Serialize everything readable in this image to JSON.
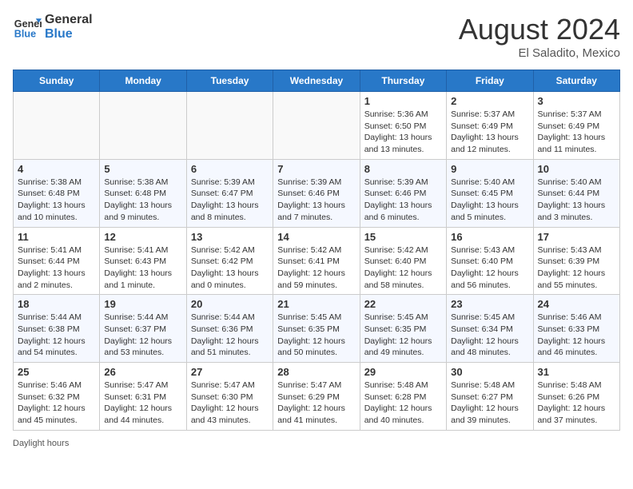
{
  "header": {
    "logo_line1": "General",
    "logo_line2": "Blue",
    "month_year": "August 2024",
    "location": "El Saladito, Mexico"
  },
  "days_of_week": [
    "Sunday",
    "Monday",
    "Tuesday",
    "Wednesday",
    "Thursday",
    "Friday",
    "Saturday"
  ],
  "footer_text": "Daylight hours",
  "weeks": [
    [
      {
        "day": "",
        "info": ""
      },
      {
        "day": "",
        "info": ""
      },
      {
        "day": "",
        "info": ""
      },
      {
        "day": "",
        "info": ""
      },
      {
        "day": "1",
        "info": "Sunrise: 5:36 AM\nSunset: 6:50 PM\nDaylight: 13 hours\nand 13 minutes."
      },
      {
        "day": "2",
        "info": "Sunrise: 5:37 AM\nSunset: 6:49 PM\nDaylight: 13 hours\nand 12 minutes."
      },
      {
        "day": "3",
        "info": "Sunrise: 5:37 AM\nSunset: 6:49 PM\nDaylight: 13 hours\nand 11 minutes."
      }
    ],
    [
      {
        "day": "4",
        "info": "Sunrise: 5:38 AM\nSunset: 6:48 PM\nDaylight: 13 hours\nand 10 minutes."
      },
      {
        "day": "5",
        "info": "Sunrise: 5:38 AM\nSunset: 6:48 PM\nDaylight: 13 hours\nand 9 minutes."
      },
      {
        "day": "6",
        "info": "Sunrise: 5:39 AM\nSunset: 6:47 PM\nDaylight: 13 hours\nand 8 minutes."
      },
      {
        "day": "7",
        "info": "Sunrise: 5:39 AM\nSunset: 6:46 PM\nDaylight: 13 hours\nand 7 minutes."
      },
      {
        "day": "8",
        "info": "Sunrise: 5:39 AM\nSunset: 6:46 PM\nDaylight: 13 hours\nand 6 minutes."
      },
      {
        "day": "9",
        "info": "Sunrise: 5:40 AM\nSunset: 6:45 PM\nDaylight: 13 hours\nand 5 minutes."
      },
      {
        "day": "10",
        "info": "Sunrise: 5:40 AM\nSunset: 6:44 PM\nDaylight: 13 hours\nand 3 minutes."
      }
    ],
    [
      {
        "day": "11",
        "info": "Sunrise: 5:41 AM\nSunset: 6:44 PM\nDaylight: 13 hours\nand 2 minutes."
      },
      {
        "day": "12",
        "info": "Sunrise: 5:41 AM\nSunset: 6:43 PM\nDaylight: 13 hours\nand 1 minute."
      },
      {
        "day": "13",
        "info": "Sunrise: 5:42 AM\nSunset: 6:42 PM\nDaylight: 13 hours\nand 0 minutes."
      },
      {
        "day": "14",
        "info": "Sunrise: 5:42 AM\nSunset: 6:41 PM\nDaylight: 12 hours\nand 59 minutes."
      },
      {
        "day": "15",
        "info": "Sunrise: 5:42 AM\nSunset: 6:40 PM\nDaylight: 12 hours\nand 58 minutes."
      },
      {
        "day": "16",
        "info": "Sunrise: 5:43 AM\nSunset: 6:40 PM\nDaylight: 12 hours\nand 56 minutes."
      },
      {
        "day": "17",
        "info": "Sunrise: 5:43 AM\nSunset: 6:39 PM\nDaylight: 12 hours\nand 55 minutes."
      }
    ],
    [
      {
        "day": "18",
        "info": "Sunrise: 5:44 AM\nSunset: 6:38 PM\nDaylight: 12 hours\nand 54 minutes."
      },
      {
        "day": "19",
        "info": "Sunrise: 5:44 AM\nSunset: 6:37 PM\nDaylight: 12 hours\nand 53 minutes."
      },
      {
        "day": "20",
        "info": "Sunrise: 5:44 AM\nSunset: 6:36 PM\nDaylight: 12 hours\nand 51 minutes."
      },
      {
        "day": "21",
        "info": "Sunrise: 5:45 AM\nSunset: 6:35 PM\nDaylight: 12 hours\nand 50 minutes."
      },
      {
        "day": "22",
        "info": "Sunrise: 5:45 AM\nSunset: 6:35 PM\nDaylight: 12 hours\nand 49 minutes."
      },
      {
        "day": "23",
        "info": "Sunrise: 5:45 AM\nSunset: 6:34 PM\nDaylight: 12 hours\nand 48 minutes."
      },
      {
        "day": "24",
        "info": "Sunrise: 5:46 AM\nSunset: 6:33 PM\nDaylight: 12 hours\nand 46 minutes."
      }
    ],
    [
      {
        "day": "25",
        "info": "Sunrise: 5:46 AM\nSunset: 6:32 PM\nDaylight: 12 hours\nand 45 minutes."
      },
      {
        "day": "26",
        "info": "Sunrise: 5:47 AM\nSunset: 6:31 PM\nDaylight: 12 hours\nand 44 minutes."
      },
      {
        "day": "27",
        "info": "Sunrise: 5:47 AM\nSunset: 6:30 PM\nDaylight: 12 hours\nand 43 minutes."
      },
      {
        "day": "28",
        "info": "Sunrise: 5:47 AM\nSunset: 6:29 PM\nDaylight: 12 hours\nand 41 minutes."
      },
      {
        "day": "29",
        "info": "Sunrise: 5:48 AM\nSunset: 6:28 PM\nDaylight: 12 hours\nand 40 minutes."
      },
      {
        "day": "30",
        "info": "Sunrise: 5:48 AM\nSunset: 6:27 PM\nDaylight: 12 hours\nand 39 minutes."
      },
      {
        "day": "31",
        "info": "Sunrise: 5:48 AM\nSunset: 6:26 PM\nDaylight: 12 hours\nand 37 minutes."
      }
    ]
  ]
}
